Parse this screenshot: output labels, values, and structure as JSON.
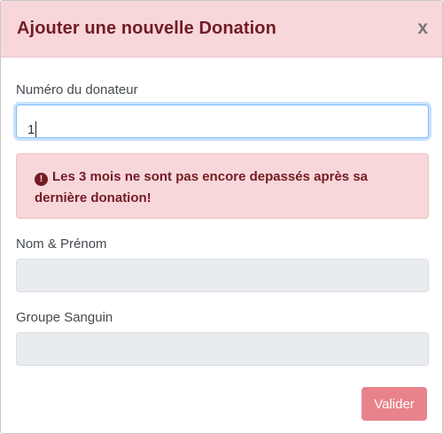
{
  "modal": {
    "title": "Ajouter une nouvelle Donation",
    "close_label": "x"
  },
  "form": {
    "donor_number_label": "Numéro du donateur",
    "donor_number_value": "1",
    "alert_icon": "exclamation-circle-icon",
    "alert_message": "Les 3 mois ne sont pas encore depassés après sa dernière donation!",
    "name_label": "Nom & Prénom",
    "name_value": "",
    "blood_group_label": "Groupe Sanguin",
    "blood_group_value": ""
  },
  "footer": {
    "submit_label": "Valider"
  },
  "colors": {
    "header_bg": "#f8d7da",
    "header_text": "#721c24",
    "alert_bg": "#f8d7da",
    "alert_text": "#721c24",
    "submit_bg": "#e8838c",
    "disabled_input_bg": "#e9ecef",
    "focus_border": "#80bdff"
  }
}
